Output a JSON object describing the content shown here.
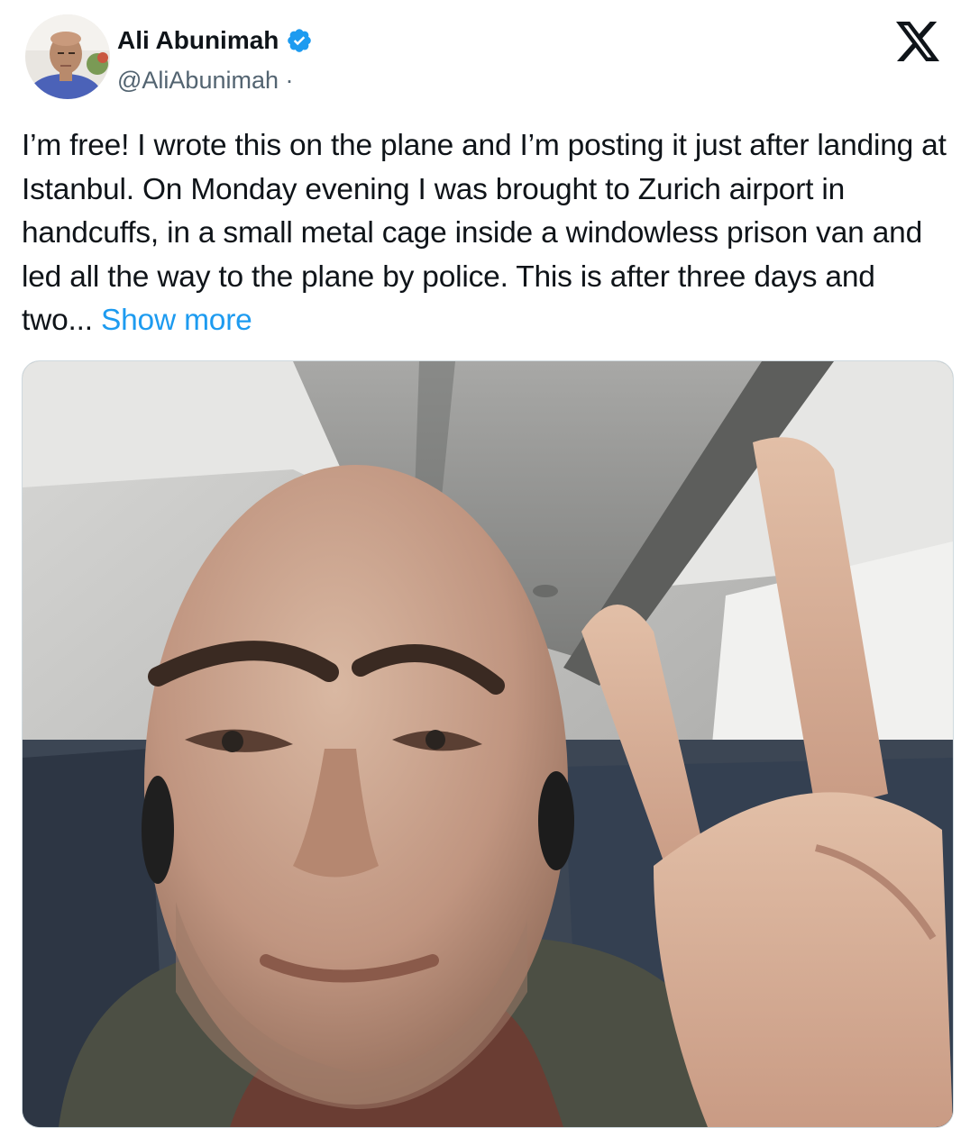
{
  "tweet": {
    "author": {
      "display_name": "Ali Abunimah",
      "handle": "@AliAbunimah",
      "separator": "·",
      "verified": true,
      "verified_badge_icon": "verified-badge-icon",
      "avatar_icon": "avatar-photo"
    },
    "platform_logo": "x-logo-icon",
    "text": "I’m free! I wrote this on the plane and I’m posting it just after landing at Istanbul. On Monday evening I was brought to Zurich airport in handcuffs, in a small metal cage inside a windowless prison van and led all the way to the plane by police. This is after three days and two...",
    "show_more_label": "Show more",
    "media": {
      "type": "photo"
    }
  },
  "colors": {
    "text_primary": "#0f1419",
    "text_secondary": "#536471",
    "link": "#1d9bf0",
    "verified": "#1d9bf0"
  }
}
